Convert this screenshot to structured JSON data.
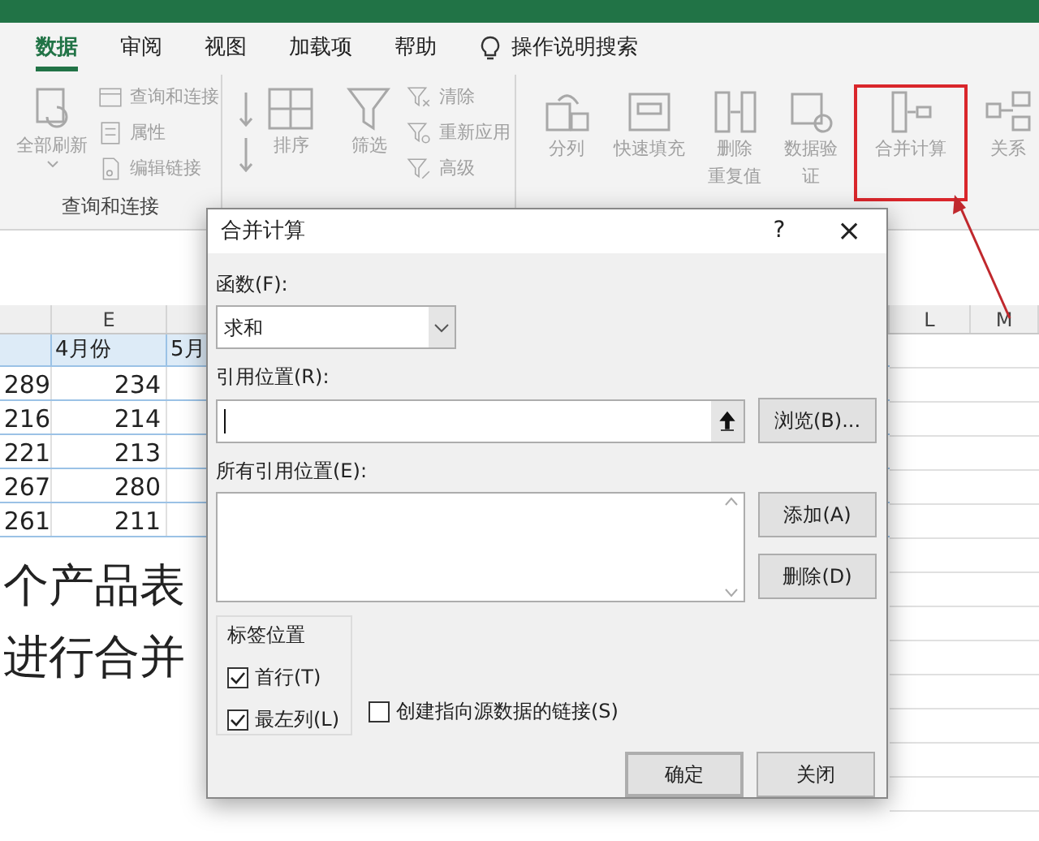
{
  "tabs": [
    {
      "label": "数据",
      "selected": true
    },
    {
      "label": "审阅",
      "selected": false
    },
    {
      "label": "视图",
      "selected": false
    },
    {
      "label": "加载项",
      "selected": false
    },
    {
      "label": "帮助",
      "selected": false
    }
  ],
  "search": {
    "label": "操作说明搜索"
  },
  "ribbon": {
    "group_1": {
      "large": {
        "label": "全部刷新"
      },
      "small": [
        "查询和连接",
        "属性",
        "编辑链接"
      ],
      "label": "查询和连接"
    },
    "group_2": {
      "sort": {
        "label": "排序"
      },
      "filter": {
        "label": "筛选"
      },
      "small": [
        "清除",
        "重新应用",
        "高级"
      ]
    },
    "group_3": [
      {
        "lines": [
          "分列"
        ],
        "highlighted": false
      },
      {
        "lines": [
          "快速填充"
        ],
        "highlighted": false
      },
      {
        "lines": [
          "删除",
          "重复值"
        ],
        "highlighted": false
      },
      {
        "lines": [
          "数据验",
          "证"
        ],
        "highlighted": false
      },
      {
        "lines": [
          "合并计算"
        ],
        "highlighted": true
      },
      {
        "lines": [
          "关系"
        ],
        "highlighted": false
      }
    ]
  },
  "sheet": {
    "column_headers": [
      "E",
      "L",
      "M"
    ],
    "header_row": [
      "4月份",
      "5月"
    ],
    "rows": [
      [
        "289",
        "234"
      ],
      [
        "216",
        "214"
      ],
      [
        "221",
        "213"
      ],
      [
        "267",
        "280"
      ],
      [
        "261",
        "211"
      ]
    ],
    "big_text": [
      "个产品表",
      "进行合并"
    ]
  },
  "dialog": {
    "title": "合并计算",
    "help": "?",
    "close": "×",
    "function_label": "函数(F):",
    "function_value": "求和",
    "reference_label": "引用位置(R):",
    "browse": "浏览(B)...",
    "all_references_label": "所有引用位置(E):",
    "add": "添加(A)",
    "delete": "删除(D)",
    "labels_group": "标签位置",
    "checkboxes": [
      {
        "label": "首行(T)",
        "checked": true
      },
      {
        "label": "最左列(L)",
        "checked": true
      },
      {
        "label": "创建指向源数据的链接(S)",
        "checked": false
      }
    ],
    "ok": "确定",
    "cancel": "关闭"
  }
}
